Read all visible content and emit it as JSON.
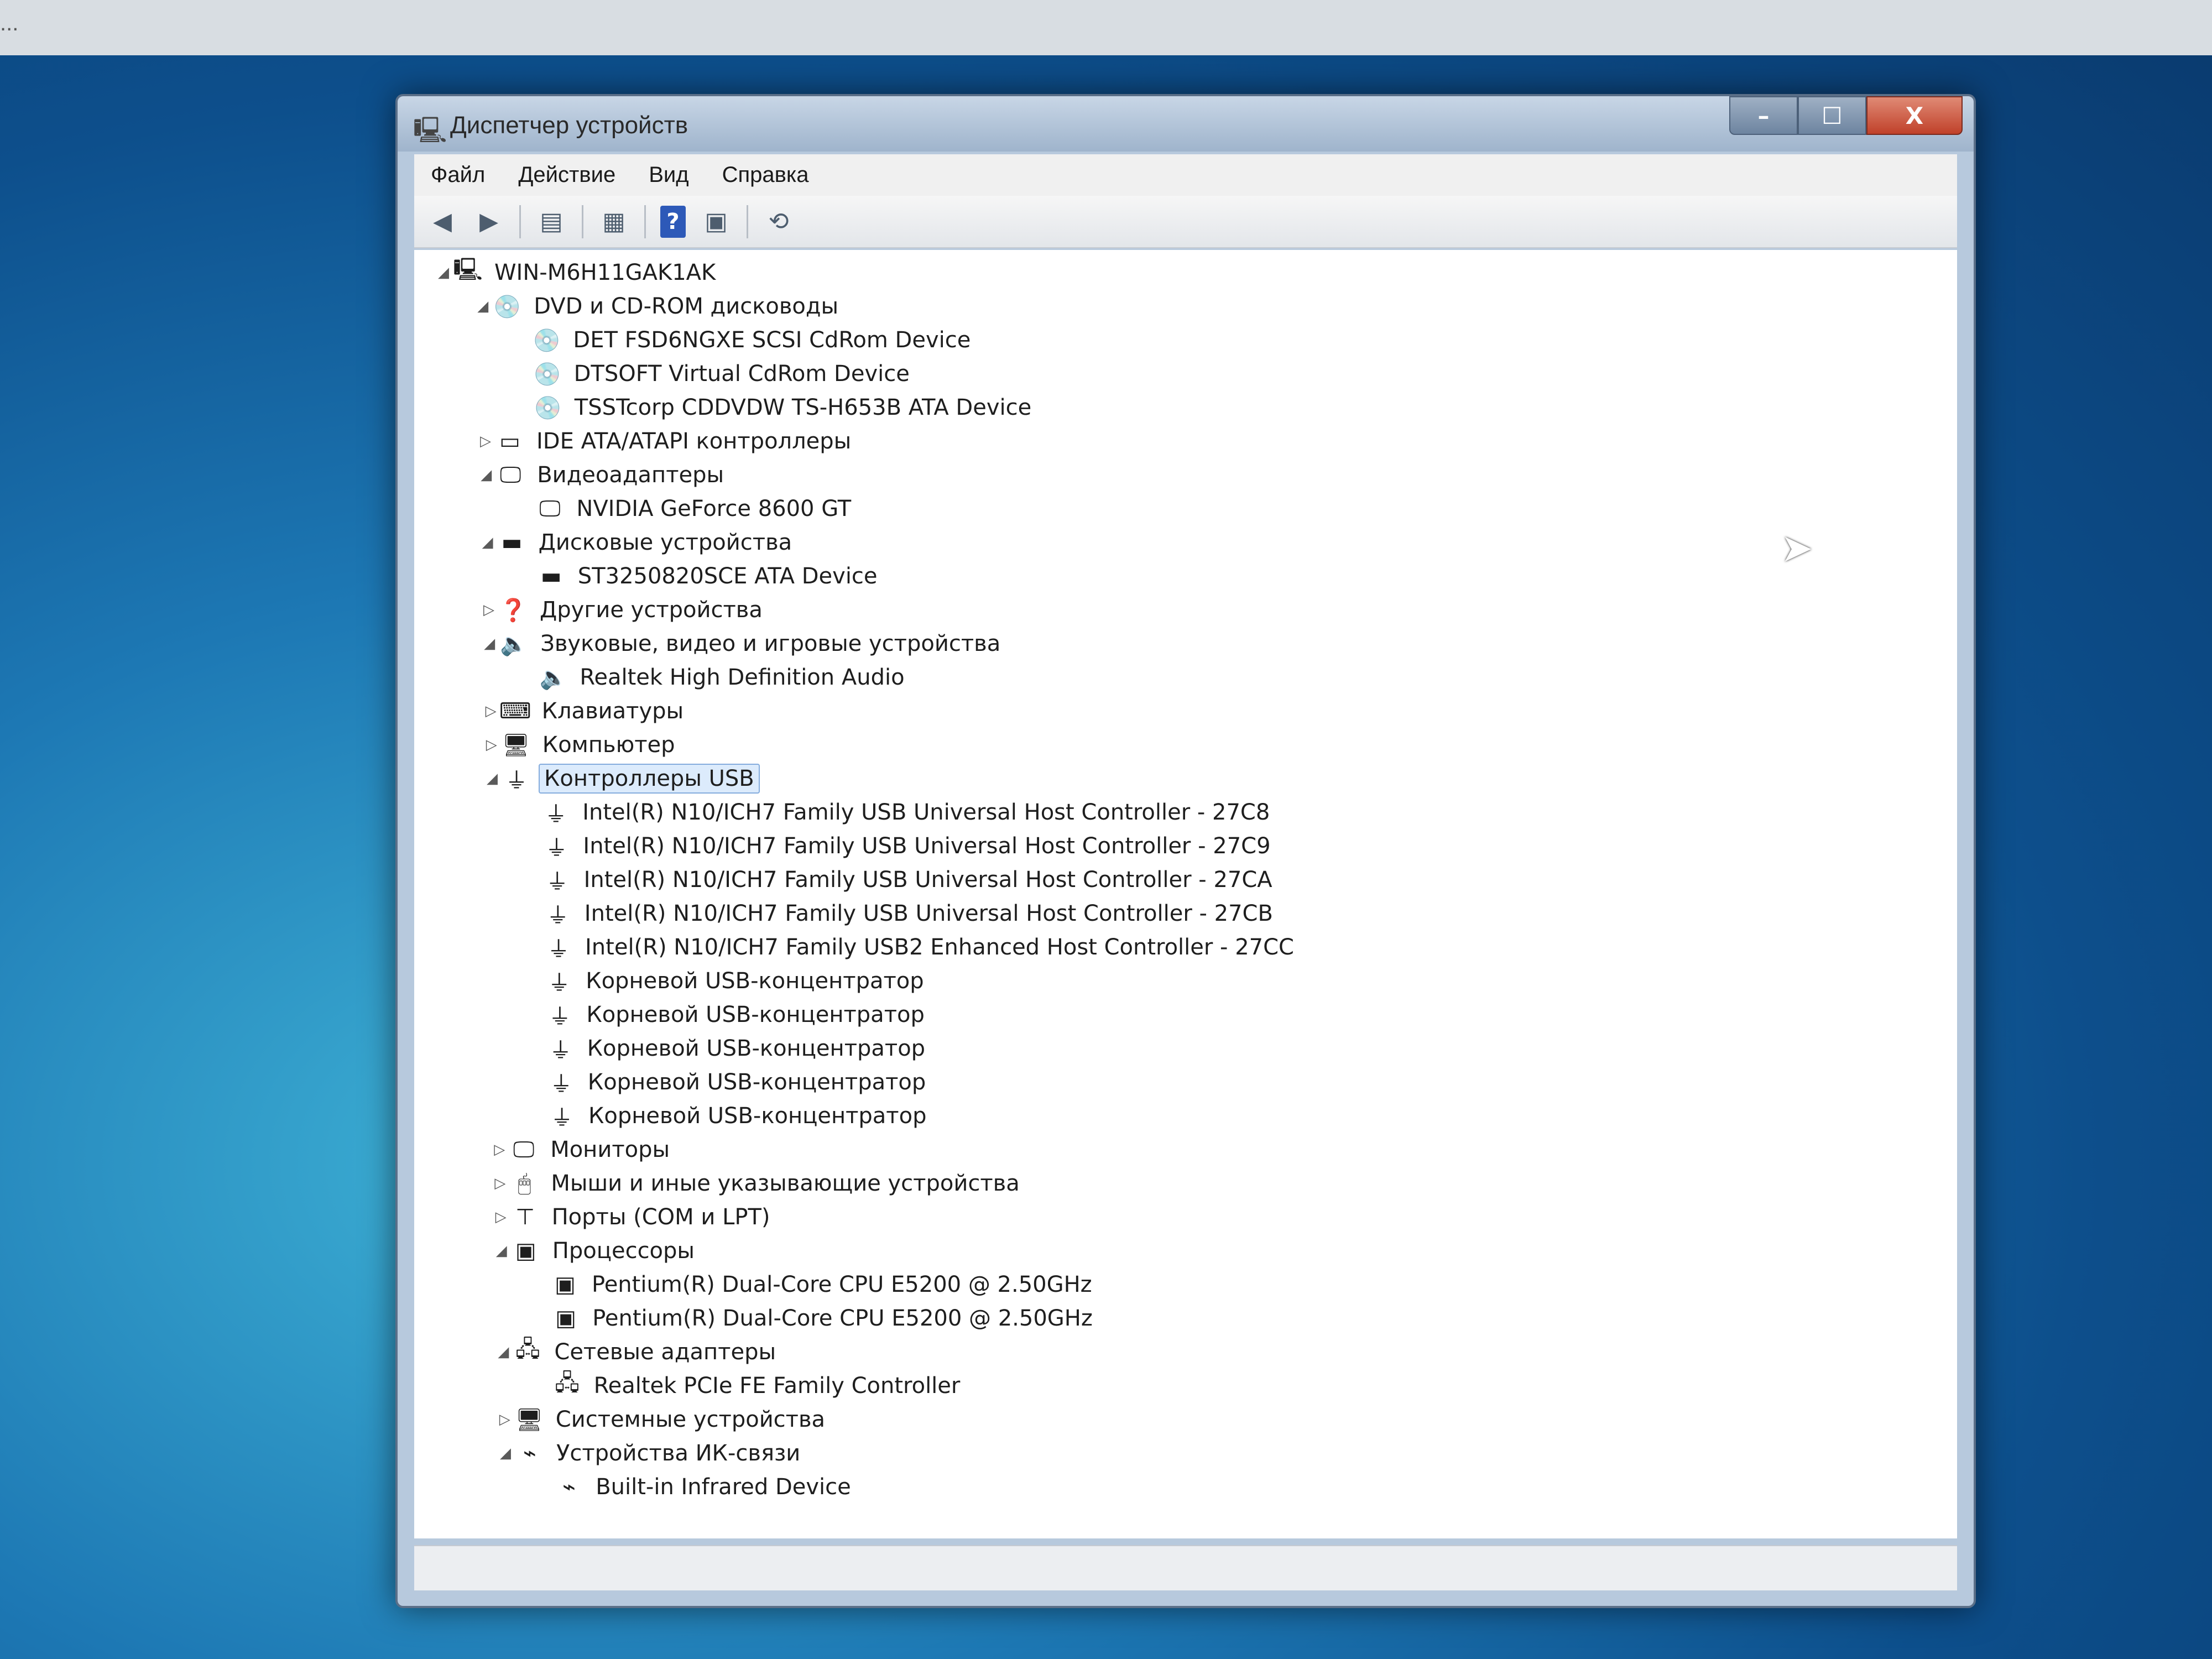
{
  "window": {
    "title": "Диспетчер устройств",
    "controls": {
      "minimize": "–",
      "maximize": "☐",
      "close": "X"
    }
  },
  "menu": [
    "Файл",
    "Действие",
    "Вид",
    "Справка"
  ],
  "toolbar": {
    "buttons": [
      "back-icon",
      "forward-icon",
      "show-hide-tree-icon",
      "properties-icon",
      "help-icon",
      "update-driver-icon",
      "scan-hardware-icon"
    ]
  },
  "tree": {
    "root": "WIN-M6H11GAK1AK",
    "categories": [
      {
        "label": "DVD и CD-ROM дисководы",
        "expanded": true,
        "icon": "cdrom-icon",
        "children": [
          "DET FSD6NGXE SCSI CdRom Device",
          "DTSOFT Virtual CdRom Device",
          "TSSTcorp CDDVDW TS-H653B ATA Device"
        ]
      },
      {
        "label": "IDE ATA/ATAPI контроллеры",
        "expanded": false,
        "icon": "ide-controller-icon",
        "children": []
      },
      {
        "label": "Видеоадаптеры",
        "expanded": true,
        "icon": "display-adapter-icon",
        "children": [
          "NVIDIA GeForce 8600 GT"
        ]
      },
      {
        "label": "Дисковые устройства",
        "expanded": true,
        "icon": "disk-drive-icon",
        "children": [
          "ST3250820SCE ATA Device"
        ]
      },
      {
        "label": "Другие устройства",
        "expanded": false,
        "icon": "unknown-device-icon",
        "children": []
      },
      {
        "label": "Звуковые, видео и игровые устройства",
        "expanded": true,
        "icon": "sound-icon",
        "children": [
          "Realtek High Definition Audio"
        ]
      },
      {
        "label": "Клавиатуры",
        "expanded": false,
        "icon": "keyboard-icon",
        "children": []
      },
      {
        "label": "Компьютер",
        "expanded": false,
        "icon": "computer-icon",
        "children": []
      },
      {
        "label": "Контроллеры USB",
        "expanded": true,
        "selected": true,
        "icon": "usb-icon",
        "children": [
          "Intel(R) N10/ICH7 Family USB Universal Host Controller - 27C8",
          "Intel(R) N10/ICH7 Family USB Universal Host Controller - 27C9",
          "Intel(R) N10/ICH7 Family USB Universal Host Controller - 27CA",
          "Intel(R) N10/ICH7 Family USB Universal Host Controller - 27CB",
          "Intel(R) N10/ICH7 Family USB2 Enhanced Host Controller - 27CC",
          "Корневой USB-концентратор",
          "Корневой USB-концентратор",
          "Корневой USB-концентратор",
          "Корневой USB-концентратор",
          "Корневой USB-концентратор"
        ]
      },
      {
        "label": "Мониторы",
        "expanded": false,
        "icon": "monitor-icon",
        "children": []
      },
      {
        "label": "Мыши и иные указывающие устройства",
        "expanded": false,
        "icon": "mouse-icon",
        "children": []
      },
      {
        "label": "Порты (COM и LPT)",
        "expanded": false,
        "icon": "port-icon",
        "children": []
      },
      {
        "label": "Процессоры",
        "expanded": true,
        "icon": "processor-icon",
        "children": [
          "Pentium(R) Dual-Core  CPU      E5200  @ 2.50GHz",
          "Pentium(R) Dual-Core  CPU      E5200  @ 2.50GHz"
        ]
      },
      {
        "label": "Сетевые адаптеры",
        "expanded": true,
        "icon": "network-adapter-icon",
        "children": [
          "Realtek PCIe FE Family Controller"
        ]
      },
      {
        "label": "Системные устройства",
        "expanded": false,
        "icon": "system-device-icon",
        "children": []
      },
      {
        "label": "Устройства ИК-связи",
        "expanded": true,
        "icon": "infrared-icon",
        "children": [
          "Built-in Infrared Device"
        ]
      }
    ]
  },
  "colors": {
    "selection": "#dcebfc",
    "selection_border": "#84acdd",
    "help_button": "#2d59b8"
  }
}
